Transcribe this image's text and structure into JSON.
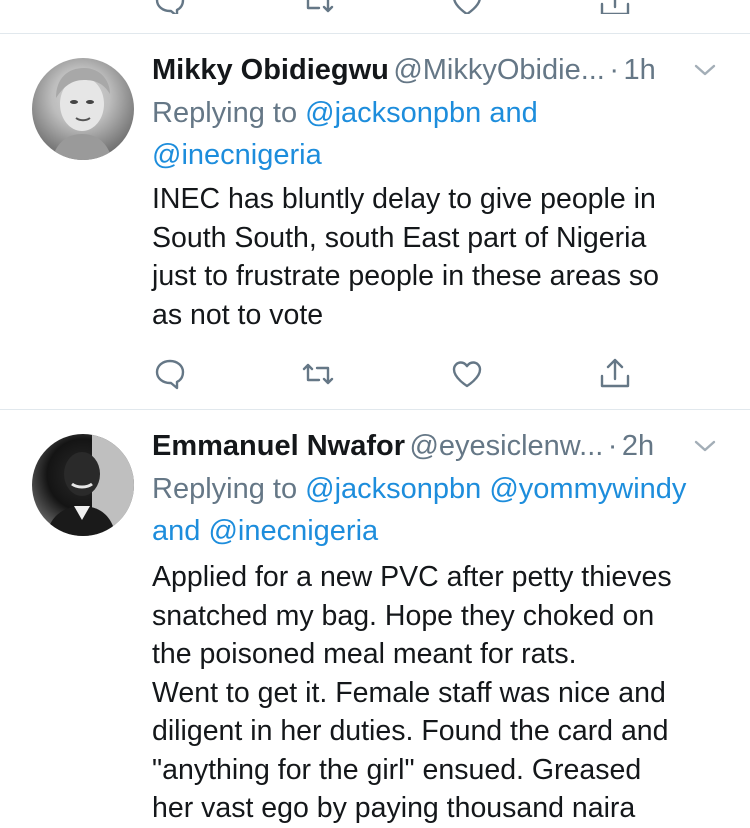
{
  "tweets": [
    {
      "name": "Mikky Obidiegwu",
      "handle": "@MikkyObidie...",
      "dot": "·",
      "time": "1h",
      "replying_prefix": "Replying to",
      "replying_line1_mentions": "@jacksonpbn and",
      "replying_line2_mentions": "@inecnigeria",
      "lines": [
        "INEC has bluntly delay to give people in",
        "South South, south East part of Nigeria",
        "just to frustrate people in these areas so",
        "as not to vote"
      ]
    },
    {
      "name": "Emmanuel Nwafor",
      "handle": "@eyesiclenw...",
      "dot": "·",
      "time": "2h",
      "replying_prefix": "Replying to",
      "replying_line1_mentions": "@jacksonpbn @yommywindy",
      "replying_line2_mentions": "and @inecnigeria",
      "lines": [
        "Applied for a new PVC after petty thieves",
        "snatched my bag. Hope they choked on",
        "the poisoned meal meant for rats.",
        "Went to get it. Female staff was nice and",
        "diligent in her duties. Found the card and",
        "\"anything for the girl\" ensued. Greased",
        "her vast ego by paying thousand naira"
      ]
    }
  ],
  "icons": [
    "reply-icon",
    "retweet-icon",
    "like-icon",
    "share-icon",
    "chevron-down-icon"
  ],
  "colors": {
    "text": "#14171a",
    "secondary": "#657786",
    "link": "#1d8ddc",
    "divider": "#e1e8ed"
  }
}
